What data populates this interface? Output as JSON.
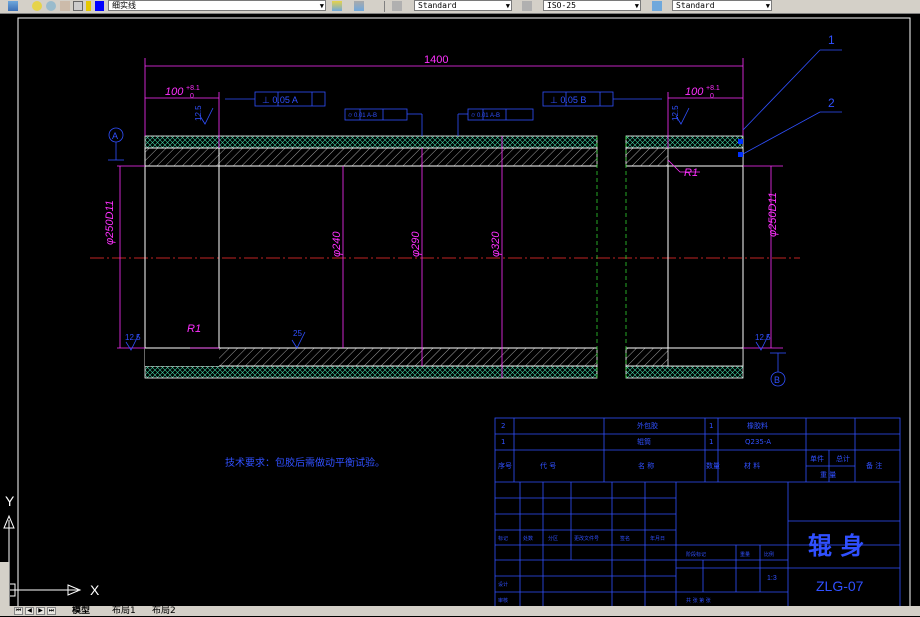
{
  "toolbar": {
    "layer_name": "细实线",
    "text_style": "Standard",
    "dim_style": "ISO-25",
    "table_style": "Standard"
  },
  "drawing": {
    "dim_total_length": "1400",
    "dim_left_length": "100",
    "dim_right_length": "100",
    "tol_left": "+8.1",
    "tol_left_low": "0",
    "tol_right": "+8.1",
    "tol_right_low": "0",
    "gdt_perp_a": "⊥ 0.05 A",
    "gdt_perp_b": "⊥ 0.05 B",
    "gdt_cyl_1": "⌭ 0.01 A-B",
    "gdt_cyl_2": "⌭ 0.01 A-B",
    "dia_outer_left": "φ250D11",
    "dia_outer_right": "φ250D11",
    "dia_240": "φ240",
    "dia_290": "φ290",
    "dia_320": "φ320",
    "radius_1": "R1",
    "radius_2": "R1",
    "rough_top": "12.5",
    "rough_bottom_left": "12.5",
    "rough_bottom_mid": "25",
    "rough_bottom_right": "12.5",
    "rough_right_top": "12.5",
    "datum_a": "A",
    "datum_b": "B",
    "leader_1": "1",
    "leader_2": "2",
    "tech_req": "技术要求：包胶后需做动平衡试验。"
  },
  "title_block": {
    "row2_seq": "2",
    "row2_name": "外包胶",
    "row2_qty": "1",
    "row2_material": "橡胶料",
    "row1_seq": "1",
    "row1_name": "辊筒",
    "row1_qty": "1",
    "row1_material": "Q235-A",
    "hdr_seq": "序号",
    "hdr_code": "代 号",
    "hdr_name": "名 称",
    "hdr_qty": "数量",
    "hdr_material": "材 料",
    "hdr_single": "单件",
    "hdr_total": "总计",
    "hdr_weight": "重 量",
    "hdr_remark": "备 注",
    "mark": "标记",
    "count": "处数",
    "zone": "分区",
    "change_no": "更改文件号",
    "sign": "签名",
    "date": "年月日",
    "design": "设计",
    "review": "审核",
    "stage_mark": "阶段标记",
    "weight": "重量",
    "scale": "比例",
    "scale_value": "1:3",
    "sheet": "共 张 第 张",
    "part_name": "辊 身",
    "drawing_no": "ZLG-07"
  },
  "axis": {
    "x_label": "X",
    "y_label": "Y"
  },
  "tabs": {
    "model": "模型",
    "layout1": "布局1",
    "layout2": "布局2"
  }
}
